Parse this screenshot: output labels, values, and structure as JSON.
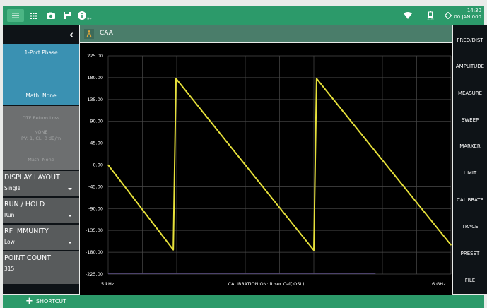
{
  "statusbar": {
    "time": "14:30",
    "date": "00 JAN 000",
    "battery_percent": "21%",
    "info_badge": "9+",
    "icons": [
      "menu-icon",
      "grid-icon",
      "camera-icon",
      "save-icon",
      "info-icon",
      "wifi-icon",
      "battery-icon",
      "diamond-icon"
    ]
  },
  "sidebar": {
    "trace1": {
      "title": "1-Port Phase",
      "math": "Math: None"
    },
    "trace2": {
      "title": "DTF Return Loss",
      "line1": "NONE",
      "line2": "PV: 1, CL: 0 dB/m",
      "math": "Math: None"
    },
    "items": [
      {
        "label": "DISPLAY LAYOUT",
        "value": "Single"
      },
      {
        "label": "RUN / HOLD",
        "value": "Run"
      },
      {
        "label": "RF IMMUNITY",
        "value": "Low"
      },
      {
        "label": "POINT COUNT",
        "value": "315"
      }
    ]
  },
  "header": {
    "title": "CAA"
  },
  "right_menu": [
    "FREQ/DIST",
    "AMPLITUDE",
    "MEASURE",
    "SWEEP",
    "MARKER",
    "LIMIT",
    "CALIBRATE",
    "TRACE",
    "PRESET",
    "FILE"
  ],
  "footer": {
    "shortcut_label": "SHORTCUT"
  },
  "colors": {
    "trace": "#e6e03a",
    "accent": "#2c9a6a",
    "selected": "#3a91b2"
  },
  "chart_data": {
    "type": "line",
    "title": "",
    "xlabel": "CALIBRATION ON: iUser Cal(iOSL)",
    "ylabel": "",
    "x_start_label": "5 kHz",
    "x_stop_label": "6 GHz",
    "ylim": [
      -225,
      225
    ],
    "yticks": [
      225.0,
      180.0,
      135.0,
      90.0,
      45.0,
      0.0,
      -45.0,
      -90.0,
      -135.0,
      -180.0,
      -225.0
    ],
    "ytick_labels": [
      "225.00",
      "180.00",
      "135.00",
      "90.00",
      "45.00",
      "0.00",
      "-45.00",
      "-90.00",
      "-135.00",
      "-180.00",
      "-225.00"
    ],
    "xlim": [
      0,
      1
    ],
    "grid": true,
    "series": [
      {
        "x": [
          0.0,
          0.19,
          0.198,
          0.6,
          0.608,
          1.0
        ],
        "y": [
          0,
          -175,
          178,
          -176,
          178,
          -165
        ]
      }
    ]
  }
}
